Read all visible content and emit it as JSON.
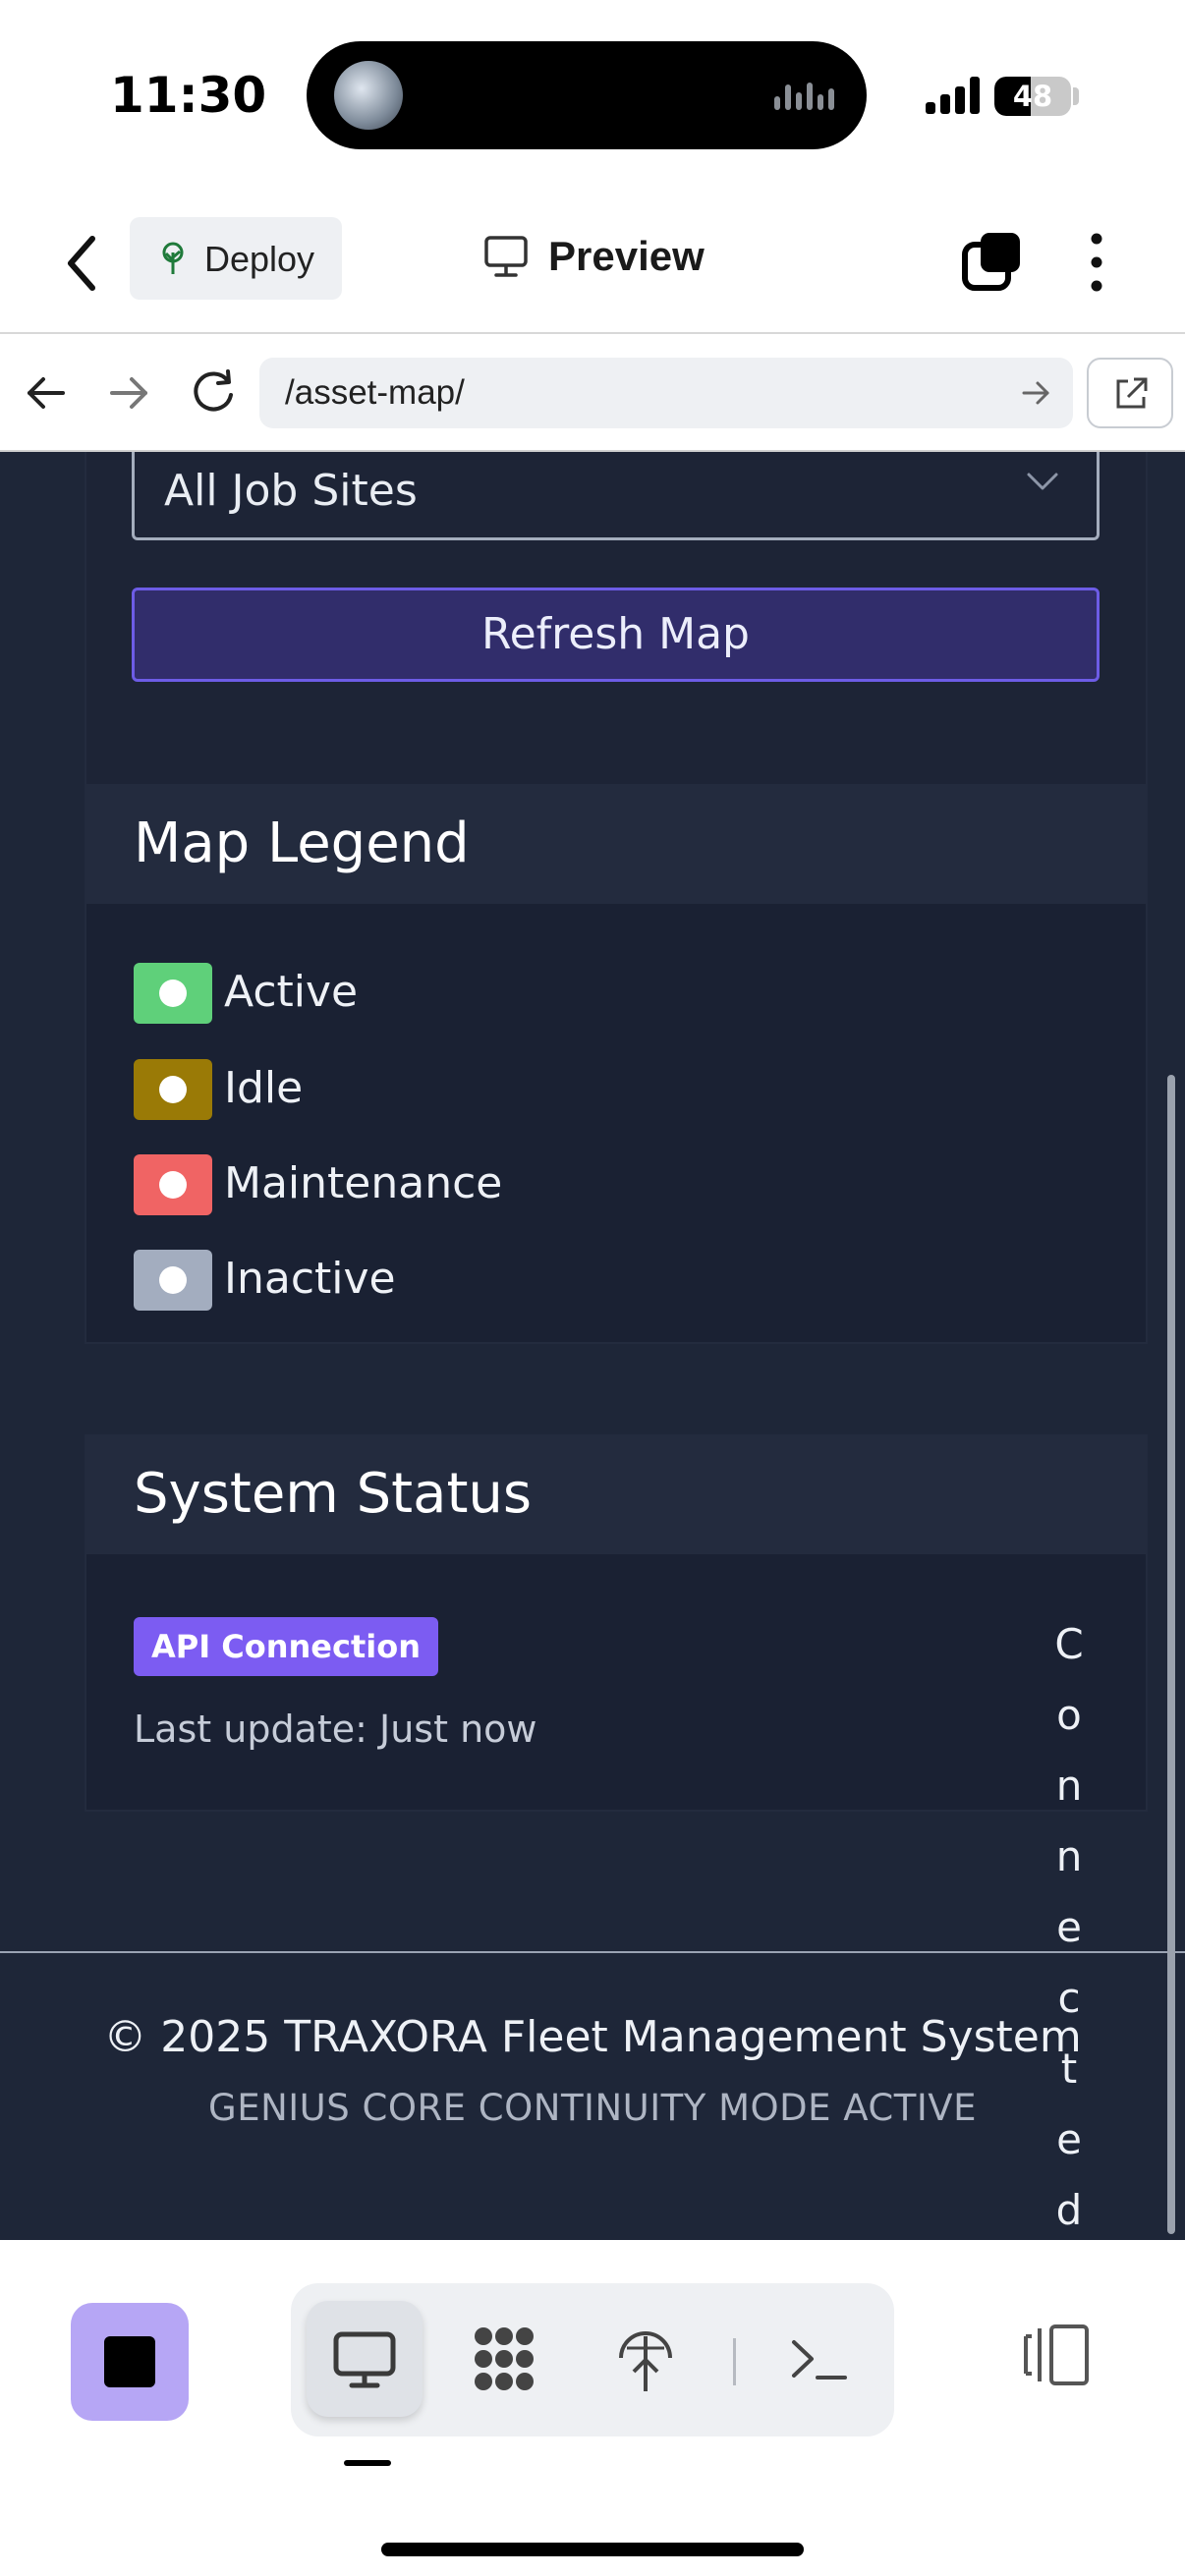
{
  "status_bar": {
    "time": "11:30",
    "battery": "48",
    "battery_level": 0.48
  },
  "header": {
    "deploy_label": "Deploy",
    "preview_label": "Preview"
  },
  "browser": {
    "url": "/asset-map/"
  },
  "filters": {
    "job_site_selected": "All Job Sites",
    "refresh_label": "Refresh Map"
  },
  "legend": {
    "title": "Map Legend",
    "items": [
      {
        "label": "Active",
        "color": "#5fd07a"
      },
      {
        "label": "Idle",
        "color": "#9a7a06"
      },
      {
        "label": "Maintenance",
        "color": "#f06464"
      },
      {
        "label": "Inactive",
        "color": "#a3adbf"
      }
    ]
  },
  "system_status": {
    "title": "System Status",
    "badge": "API Connection",
    "last_update": "Last update: Just now",
    "connection_state": "Connected"
  },
  "footer": {
    "copyright": "© 2025 TRAXORA Fleet Management System",
    "mode": "GENIUS CORE CONTINUITY MODE ACTIVE"
  },
  "icons": {
    "back": "chevron-left-icon",
    "deploy": "tree-icon",
    "preview": "monitor-icon",
    "tabs": "tabs-icon",
    "more": "more-vertical-icon",
    "nav_back": "arrow-left-icon",
    "nav_forward": "arrow-right-icon",
    "reload": "reload-icon",
    "go": "arrow-right-icon",
    "open_external": "external-link-icon",
    "bottom": [
      "stop-icon",
      "monitor-icon",
      "agents-icon",
      "deploy-icon",
      "terminal-icon",
      "panel-icon"
    ]
  },
  "colors": {
    "page_bg": "#1e2638",
    "card_header": "#232b3e",
    "accent": "#7c5cf2",
    "refresh_bg": "#312d6b"
  }
}
